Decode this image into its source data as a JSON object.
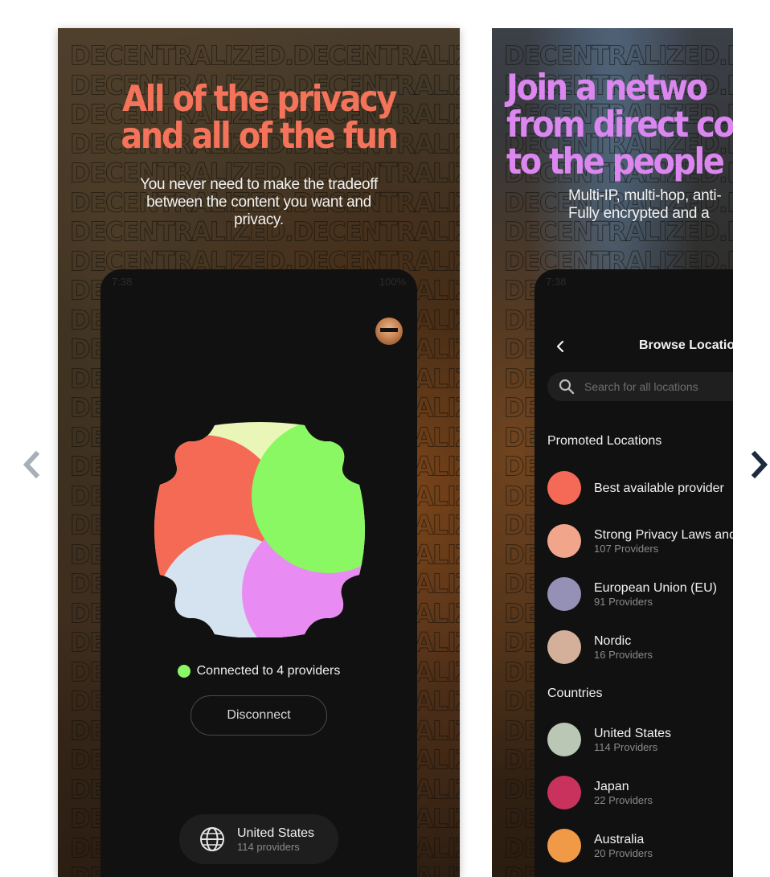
{
  "carousel": {
    "prev_icon": "chevron-left-icon",
    "next_icon": "chevron-right-icon"
  },
  "pattern_word": "DECENTRALIZED.",
  "slide1": {
    "headline": [
      "All of the privacy",
      "and all of the fun"
    ],
    "subhead": [
      "You never need to make the tradeoff",
      "between the content you want and",
      "privacy."
    ],
    "phone": {
      "status_time": "7:38",
      "status_right": "100%",
      "connection_status": "Connected to 4 providers",
      "disconnect_label": "Disconnect",
      "location": {
        "name": "United States",
        "sub": "114 providers",
        "icon": "globe-icon"
      }
    }
  },
  "slide2": {
    "headline": [
      "Join a netwo",
      "from direct co",
      "to the people a"
    ],
    "subhead": [
      "Multi-IP, multi-hop, anti-",
      "Fully encrypted and a"
    ],
    "phone": {
      "status_time": "7:38",
      "title": "Browse Locatio",
      "search_placeholder": "Search for all locations",
      "promoted_label": "Promoted Locations",
      "promoted": [
        {
          "name": "Best available provider",
          "sub": "",
          "color": "#f56a57"
        },
        {
          "name": "Strong Privacy Laws and",
          "sub": "107 Providers",
          "color": "#f1a58a"
        },
        {
          "name": "European Union (EU)",
          "sub": "91 Providers",
          "color": "#9590b5"
        },
        {
          "name": "Nordic",
          "sub": "16 Providers",
          "color": "#d4b09a"
        }
      ],
      "countries_label": "Countries",
      "countries": [
        {
          "name": "United States",
          "sub": "114 Providers",
          "color": "#b9c7b4"
        },
        {
          "name": "Japan",
          "sub": "22 Providers",
          "color": "#c8325c"
        },
        {
          "name": "Australia",
          "sub": "20 Providers",
          "color": "#f09a48"
        }
      ]
    }
  },
  "colors": {
    "accent_coral": "#f4735a",
    "accent_violet": "#dc86f0",
    "connected_green": "#8af764",
    "blob_coral": "#f46a55",
    "blob_green": "#89f863",
    "blob_cream": "#eaf5b8",
    "blob_lightblue": "#d5e3f0",
    "blob_pink": "#e88cf3"
  }
}
